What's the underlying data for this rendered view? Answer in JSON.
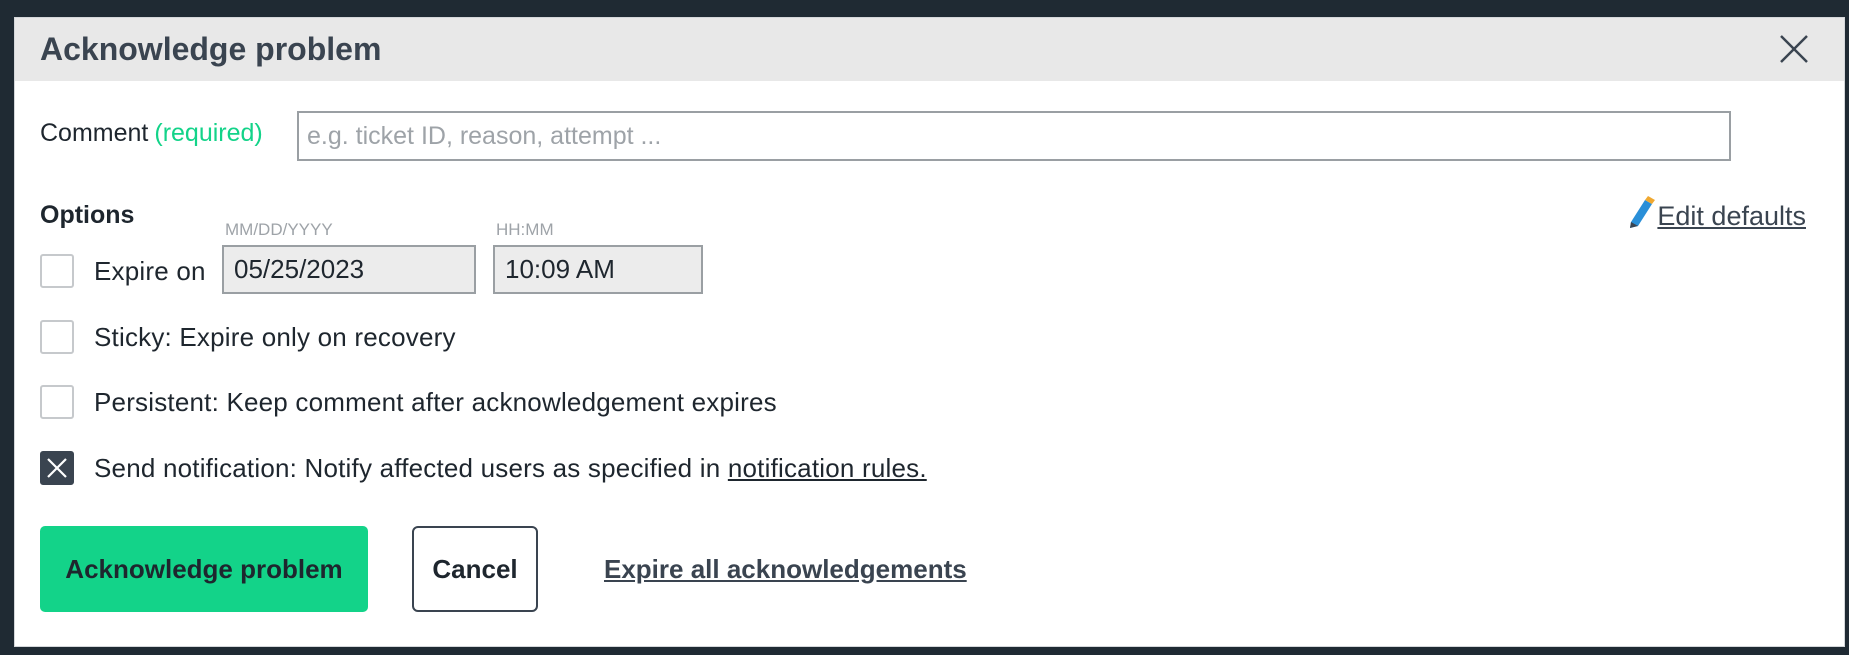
{
  "dialog": {
    "title": "Acknowledge problem",
    "close_icon": "close-icon"
  },
  "comment": {
    "label": "Comment",
    "required": "(required)",
    "placeholder": "e.g. ticket ID, reason, attempt ...",
    "value": ""
  },
  "options": {
    "title": "Options",
    "edit_defaults": "Edit defaults",
    "edit_icon": "pencil-icon",
    "date_hint": "MM/DD/YYYY",
    "time_hint": "HH:MM",
    "expire_on": {
      "label": "Expire on",
      "checked": false,
      "date": "05/25/2023",
      "time": "10:09 AM"
    },
    "sticky": {
      "label": "Sticky: Expire only on recovery",
      "checked": false
    },
    "persistent": {
      "label": "Persistent: Keep comment after acknowledgement expires",
      "checked": false
    },
    "notification": {
      "label": "Send notification: Notify affected users as specified in",
      "link": "notification rules.",
      "checked": true
    }
  },
  "actions": {
    "acknowledge": "Acknowledge problem",
    "cancel": "Cancel",
    "expire_all": "Expire all acknowledgements"
  },
  "colors": {
    "accent": "#13d389",
    "header_bg": "#e8e8e8",
    "text_dark": "#3a4450",
    "background": "#1f2a33"
  }
}
